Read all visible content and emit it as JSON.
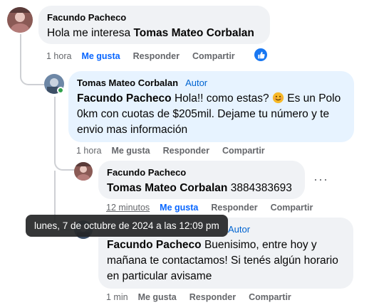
{
  "comments": [
    {
      "author": "Facundo Pacheco",
      "mention": "Tomas Mateo Corbalan",
      "text": "Hola me interesa ",
      "time": "1 hora",
      "like": "Me gusta",
      "reply": "Responder",
      "share": "Compartir",
      "reaction_icon": "thumbs-up-icon"
    },
    {
      "author": "Tomas Mateo Corbalan",
      "badge": "Autor",
      "mention": "Facundo Pacheco",
      "text_a": " Hola!! como estas? ",
      "emoji": "smiling-face-icon",
      "text_b": " Es un Polo 0km con cuotas de $205mil. Dejame tu número y te envio mas información",
      "time": "1 hora",
      "like": "Me gusta",
      "reply": "Responder",
      "share": "Compartir"
    },
    {
      "author": "Facundo Pacheco",
      "mention": "Tomas Mateo Corbalan",
      "text": " 3884383693",
      "time": "12 minutos",
      "like": "Me gusta",
      "reply": "Responder",
      "share": "Compartir",
      "more": "···"
    },
    {
      "badge": "Autor",
      "mention": "Facundo Pacheco",
      "text": " Buenisimo, entre hoy y mañana te contactamos! Si tenés algún horario en particular avisame",
      "time": "1 min",
      "like": "Me gusta",
      "reply": "Responder",
      "share": "Compartir"
    }
  ],
  "tooltip": "lunes, 7 de octubre de 2024 a las 12:09 pm",
  "colors": {
    "accent": "#0866ff",
    "bubble_gray": "#f0f2f5",
    "bubble_blue": "#e7f3ff",
    "online": "#31a24c"
  }
}
